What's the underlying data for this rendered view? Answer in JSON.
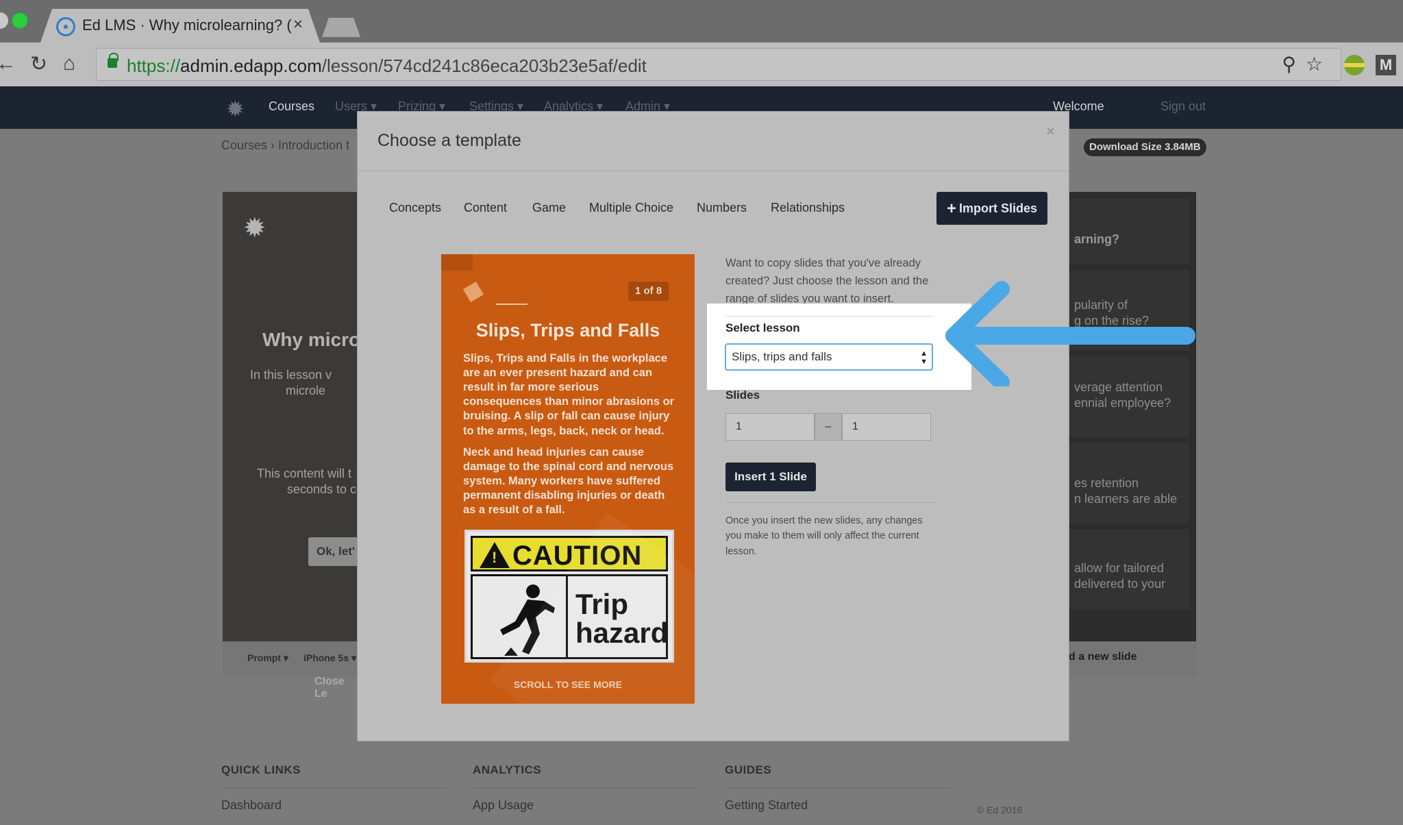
{
  "browser": {
    "tab_title": "Ed LMS · Why microlearning? ( ",
    "tab_close": "×",
    "url": {
      "scheme": "https://",
      "host": "admin.edapp.com",
      "path": "/lesson/574cd241c86eca203b23e5af/edit"
    },
    "nav_back": "←",
    "nav_reload": "↻",
    "nav_home": "⌂",
    "addr_icons": "⚲☆",
    "ext_badge": "M"
  },
  "appnav": {
    "logo": "✹",
    "items": [
      "Courses",
      "Users ▾",
      "Prizing ▾",
      "Settings ▾",
      "Analytics ▾",
      "Admin ▾"
    ],
    "welcome": "Welcome",
    "signout": "Sign out"
  },
  "page": {
    "breadcrumb": "Courses  ›  Introduction t",
    "download_badge": "Download Size 3.84MB",
    "preview": {
      "gear": "✹",
      "title": "Why micro",
      "text_lines": [
        "In this lesson v",
        "microle"
      ],
      "text_lines2": [
        "This content will t",
        "seconds to c"
      ],
      "button": "Ok, let'",
      "close": "Close Le"
    },
    "bottom_bar": {
      "prompt": "Prompt ▾",
      "device": "iPhone 5s ▾"
    },
    "right_items": [
      "arning?",
      "pularity of",
      "g on the rise?",
      "verage attention",
      "ennial employee?",
      "es retention",
      "n learners are able",
      "allow for tailored",
      "delivered to your"
    ],
    "right_bar": "d a new slide",
    "footer": {
      "cols": [
        {
          "heading": "QUICK LINKS",
          "link": "Dashboard"
        },
        {
          "heading": "ANALYTICS",
          "link": "App Usage"
        },
        {
          "heading": "GUIDES",
          "link": "Getting Started"
        }
      ],
      "copyright": "© Ed 2016"
    }
  },
  "modal": {
    "title": "Choose a template",
    "close": "×",
    "categories": [
      "Concepts",
      "Content",
      "Game",
      "Multiple Choice",
      "Numbers",
      "Relationships"
    ],
    "import_button": "Import Slides",
    "import_plus": "+",
    "card": {
      "page_badge": "1 of 8",
      "title": "Slips, Trips and Falls",
      "paragraph1": "Slips, Trips and Falls in the workplace are an ever present hazard and can result in far more serious consequences than minor abrasions or bruising. A slip or fall can cause injury to the arms, legs, back, neck or head.",
      "paragraph2": "Neck and head injuries can cause damage to the spinal cord and nervous system. Many workers have suffered permanent disabling injuries or death as a result of a fall.",
      "sign_word": "CAUTION",
      "sign_line1": "Trip",
      "sign_line2": "hazard",
      "scroll_hint": "SCROLL TO SEE MORE"
    },
    "intro": "Want to copy slides that you've already created? Just choose the lesson and the range of slides you want to insert.",
    "select_lesson_label": "Select lesson",
    "select_lesson_value": "Slips, trips and falls",
    "slides_label": "Slides",
    "slide_from": "1",
    "slide_dash": "–",
    "slide_to": "1",
    "insert_button": "Insert 1 Slide",
    "note": "Once you insert the new slides, any changes you make to them will only affect the current lesson."
  },
  "colors": {
    "nav_dark": "#1c2331",
    "card_orange": "#c85a12",
    "arrow_blue": "#4aa8e6",
    "caution_yellow": "#e6dd2f"
  }
}
